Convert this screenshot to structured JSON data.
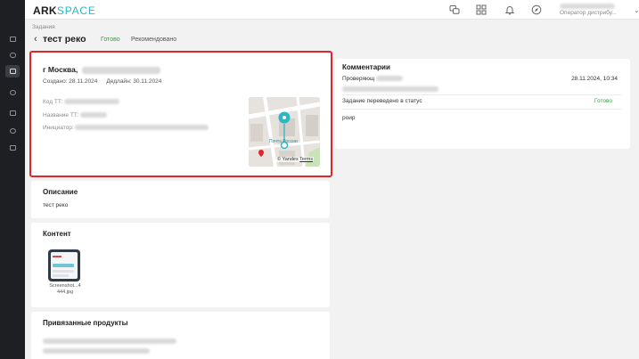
{
  "topbar": {
    "logo_part1": "ARK",
    "logo_part2": "SPACE",
    "user_role": "Оператор дистрибу..."
  },
  "breadcrumb": "Задания",
  "page": {
    "title": "тест реко",
    "status_done": "Готово",
    "status_recommended": "Рекомендовано"
  },
  "task": {
    "address_prefix": "г Москва,",
    "created": "Создано: 28.11.2024",
    "deadline": "Дедлайн: 30.11.2024",
    "fields": {
      "code_label": "Код ТТ:",
      "name_label": "Название ТТ:",
      "initiator_label": "Инициатор:"
    },
    "map": {
      "poi_label": "Почта России",
      "provider_label": "© Yandex",
      "terms_label": "Terms"
    }
  },
  "comments": {
    "heading": "Комментарии",
    "author": "Проверяющ",
    "datetime": "28.11.2024, 10:34",
    "event": "Задание переведено в статус",
    "event_status": "Готово",
    "message": "роир"
  },
  "description": {
    "heading": "Описание",
    "text": "тест реко"
  },
  "content": {
    "heading": "Контент",
    "file_name_line1": "Screenshot...4",
    "file_name_line2": "444.jpg"
  },
  "products": {
    "heading": "Привязанные продукты"
  },
  "colors": {
    "accent_teal": "#2bb7c6",
    "status_green": "#3c9b4a",
    "highlight_red": "#e0262b",
    "sidebar_bg": "#1d1f22"
  },
  "icons": {
    "sidebar": [
      "tasks-icon",
      "storage-icon",
      "layout-icon",
      "clock-icon",
      "chart-icon",
      "settings-icon",
      "calendar-icon"
    ],
    "topbar": [
      "chat-icon",
      "apps-grid-icon",
      "bell-icon",
      "compass-icon",
      "chevron-down-icon"
    ]
  }
}
